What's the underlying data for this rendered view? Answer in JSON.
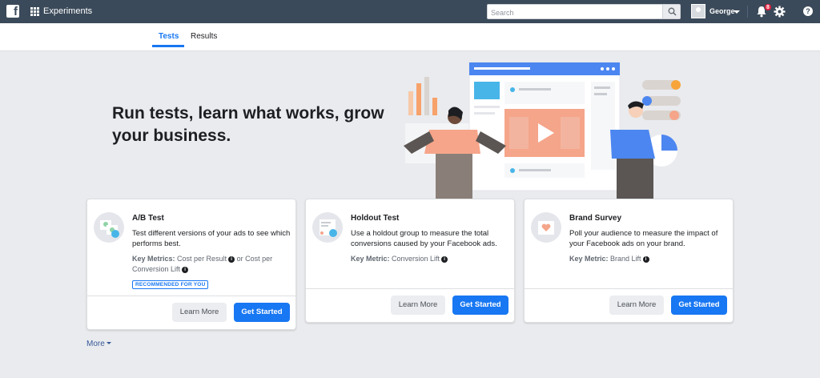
{
  "topbar": {
    "app_title": "Experiments",
    "search_placeholder": "Search",
    "user_name": "George",
    "notification_count": "8"
  },
  "tabs": [
    {
      "label": "Tests",
      "active": true
    },
    {
      "label": "Results",
      "active": false
    }
  ],
  "hero": {
    "title": "Run tests, learn what works, grow your business."
  },
  "cards": [
    {
      "title": "A/B Test",
      "description": "Test different versions of your ads to see which performs best.",
      "metric_label": "Key Metrics:",
      "metric_value_1": "Cost per Result",
      "metric_or": "or Cost per",
      "metric_value_2": "Conversion Lift",
      "badge": "RECOMMENDED FOR YOU",
      "learn_more": "Learn More",
      "get_started": "Get Started"
    },
    {
      "title": "Holdout Test",
      "description": "Use a holdout group to measure the total conversions caused by your Facebook ads.",
      "metric_label": "Key Metric:",
      "metric_value_1": "Conversion Lift",
      "learn_more": "Learn More",
      "get_started": "Get Started"
    },
    {
      "title": "Brand Survey",
      "description": "Poll your audience to measure the impact of your Facebook ads on your brand.",
      "metric_label": "Key Metric:",
      "metric_value_1": "Brand Lift",
      "learn_more": "Learn More",
      "get_started": "Get Started"
    }
  ],
  "more_label": "More",
  "colors": {
    "topbar": "#3b4a5a",
    "primary": "#1877f2",
    "background": "#e9ebee"
  }
}
